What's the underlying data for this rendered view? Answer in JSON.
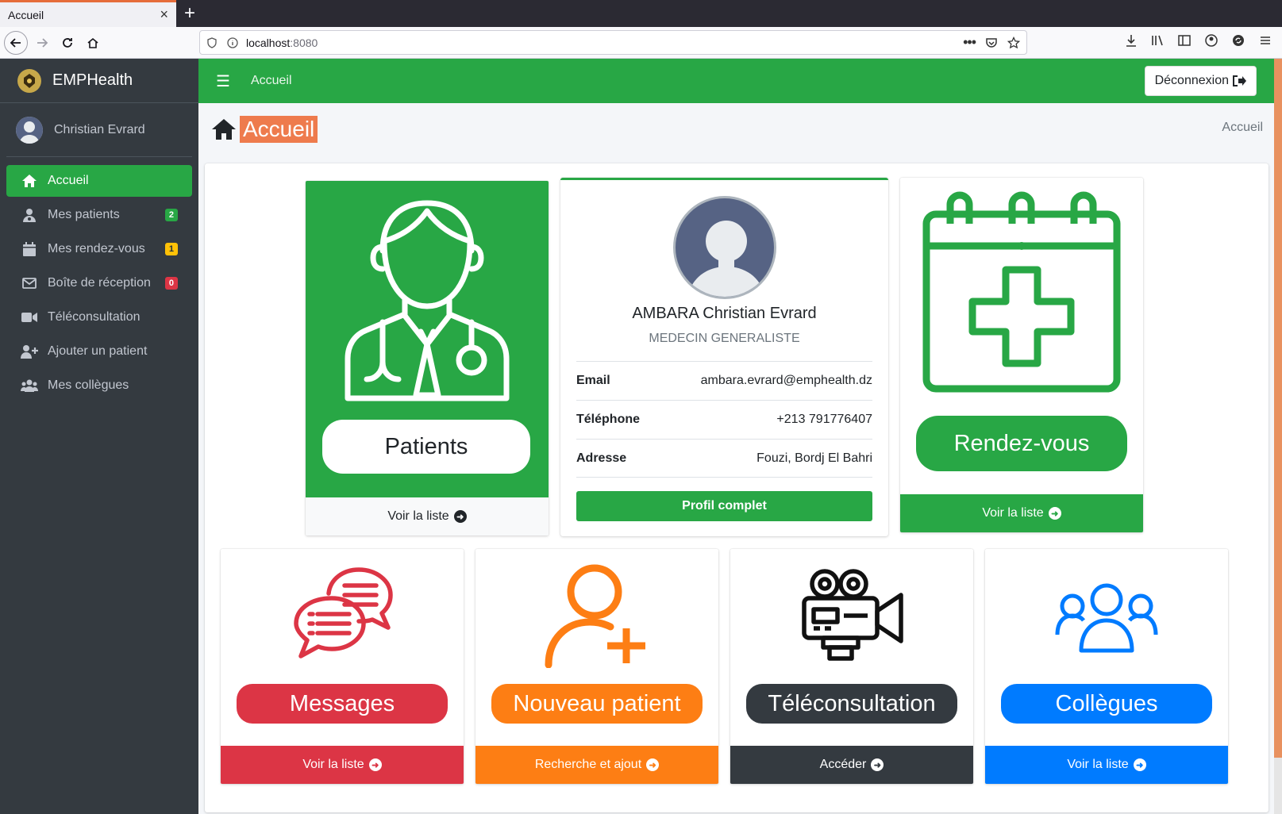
{
  "browser": {
    "tab_title": "Accueil",
    "tab_close": "×",
    "new_tab": "+",
    "url_host": "localhost",
    "url_port": ":8080"
  },
  "sidebar": {
    "brand": "EMPHealth",
    "user_name": "Christian Evrard",
    "items": [
      {
        "label": "Accueil",
        "icon": "home-icon",
        "badge": ""
      },
      {
        "label": "Mes patients",
        "icon": "user-md-icon",
        "badge": "2"
      },
      {
        "label": "Mes rendez-vous",
        "icon": "calendar-icon",
        "badge": "1"
      },
      {
        "label": "Boîte de réception",
        "icon": "envelope-icon",
        "badge": "0"
      },
      {
        "label": "Téléconsultation",
        "icon": "video-icon",
        "badge": ""
      },
      {
        "label": "Ajouter un patient",
        "icon": "user-plus-icon",
        "badge": ""
      },
      {
        "label": "Mes collègues",
        "icon": "users-icon",
        "badge": ""
      }
    ]
  },
  "topbar": {
    "link": "Accueil",
    "logout": "Déconnexion"
  },
  "header": {
    "title": "Accueil",
    "breadcrumb": "Accueil"
  },
  "profile": {
    "name": "AMBARA Christian Evrard",
    "role": "MEDECIN GENERALISTE",
    "rows": [
      {
        "label": "Email",
        "value": "ambara.evrard@emphealth.dz"
      },
      {
        "label": "Téléphone",
        "value": "+213 791776407"
      },
      {
        "label": "Adresse",
        "value": "Fouzi, Bordj El Bahri"
      }
    ],
    "button": "Profil complet"
  },
  "tiles": {
    "patients": {
      "title": "Patients",
      "footer": "Voir la liste"
    },
    "rdv": {
      "title": "Rendez-vous",
      "footer": "Voir la liste"
    },
    "messages": {
      "title": "Messages",
      "footer": "Voir la liste"
    },
    "nouveau": {
      "title": "Nouveau patient",
      "footer": "Recherche et ajout"
    },
    "tele": {
      "title": "Téléconsultation",
      "footer": "Accéder"
    },
    "collegues": {
      "title": "Collègues",
      "footer": "Voir la liste"
    }
  },
  "colors": {
    "green": "#28a745",
    "red": "#dc3545",
    "orange": "#fd7e14",
    "dark": "#343a40",
    "blue": "#007bff",
    "sidebar": "#343a40"
  }
}
